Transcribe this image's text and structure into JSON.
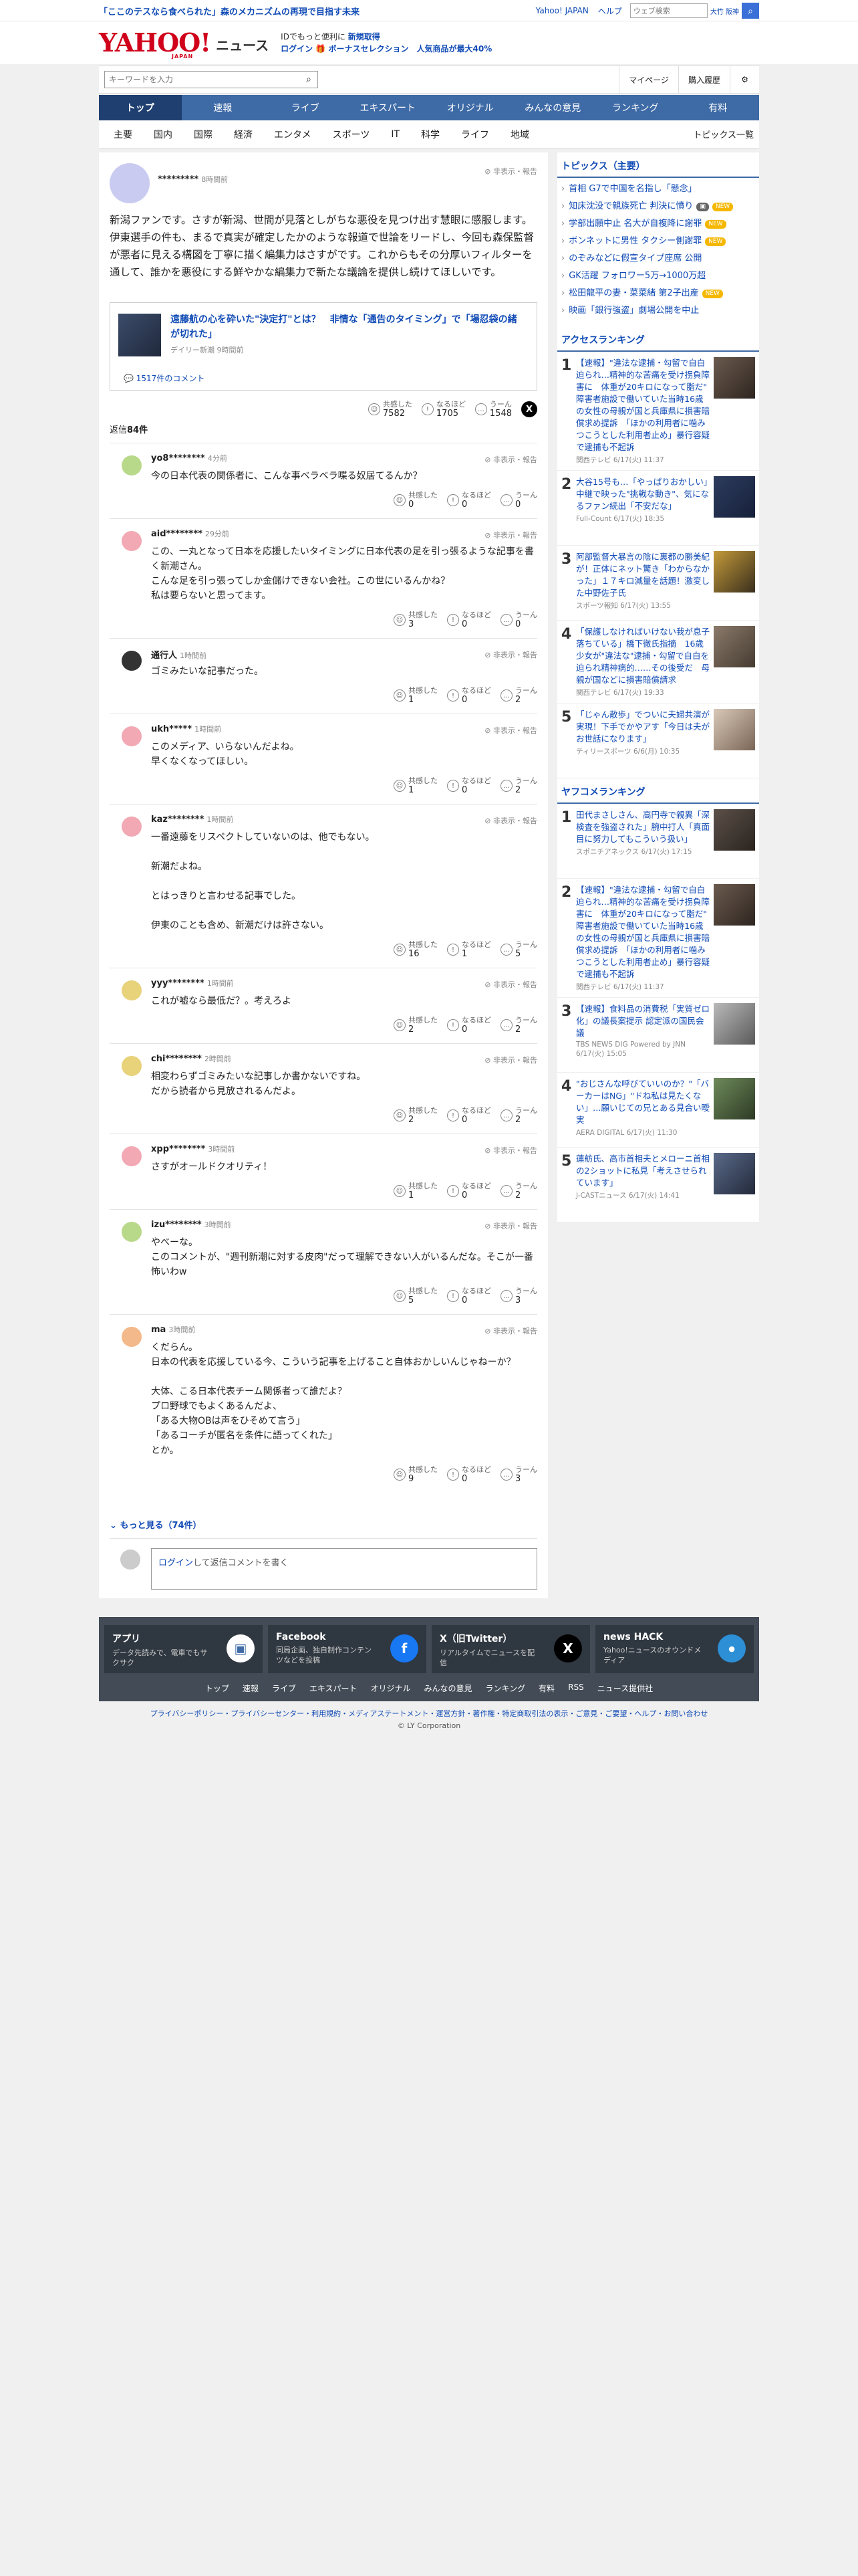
{
  "topbar": {
    "promo": "「ここのテスなら食べられた」森のメカニズムの再現で目指す未来",
    "links": [
      "Yahoo! JAPAN",
      "ヘルプ"
    ],
    "search_placeholder": "ウェブ検索",
    "search_badge": "大竹 阪神"
  },
  "header": {
    "logo": "YAHOO!",
    "logo_sub": "JAPAN",
    "service": "ニュース",
    "msg_line1_prefix": "IDでもっと便利に",
    "msg_line1_link": "新規取得",
    "msg_line2_login": "ログイン",
    "msg_line2_rest": "ボーナスセレクション　人気商品が最大40%"
  },
  "search": {
    "placeholder": "キーワードを入力",
    "links": [
      "マイページ",
      "購入履歴"
    ]
  },
  "nav": {
    "items": [
      "トップ",
      "速報",
      "ライブ",
      "エキスパート",
      "オリジナル",
      "みんなの意見",
      "ランキング",
      "有料"
    ],
    "sub": [
      "主要",
      "国内",
      "国際",
      "経済",
      "エンタメ",
      "スポーツ",
      "IT",
      "科学",
      "ライフ",
      "地域"
    ],
    "topics_all": "トピックス一覧"
  },
  "primary": {
    "user": "*********",
    "time": "8時間前",
    "report": "非表示・報告",
    "body": "新潟ファンです。さすが新潟、世間が見落としがちな悪役を見つけ出す慧眼に感服します。伊東選手の件も、まるで真実が確定したかのような報道で世論をリードし、今回も森保監督が悪者に見える構図を丁寧に描く編集力はさすがです。これからもその分厚いフィルターを通して、誰かを悪役にする鮮やかな編集力で新たな議論を提供し続けてほしいです。",
    "article_title": "遠藤航の心を砕いた\"決定打\"とは？　非情な「通告のタイミング」で「場忍袋の緒が切れた」",
    "article_src": "デイリー新潮 9時間前",
    "article_comments": "1517件のコメント",
    "r1_label": "共感した",
    "r1": "7582",
    "r2_label": "なるほど",
    "r2": "1705",
    "r3_label": "うーん",
    "r3": "1548"
  },
  "reply_count_label": "返信",
  "reply_count": "84件",
  "replies": [
    {
      "user": "yo8********",
      "time": "4分前",
      "text": "今の日本代表の関係者に、こんな事ベラベラ喋る奴居てるんか？",
      "a": "0",
      "b": "0",
      "c": "0",
      "color": "#b9d98a"
    },
    {
      "user": "aid********",
      "time": "29分前",
      "text": "この、一丸となって日本を応援したいタイミングに日本代表の足を引っ張るような記事を書く新潮さん。\nこんな足を引っ張ってしか金儲けできない会社。この世にいるんかね？\n私は要らないと思ってます。",
      "a": "3",
      "b": "0",
      "c": "0",
      "color": "#f2a9b4"
    },
    {
      "user": "通行人",
      "time": "1時間前",
      "text": "ゴミみたいな記事だった。",
      "a": "1",
      "b": "0",
      "c": "2",
      "color": "#333333"
    },
    {
      "user": "ukh*****",
      "time": "1時間前",
      "text": "このメディア、いらないんだよね。\n早くなくなってほしい。",
      "a": "1",
      "b": "0",
      "c": "2",
      "color": "#f2a9b4"
    },
    {
      "user": "kaz********",
      "time": "1時間前",
      "text": "一番遠藤をリスペクトしていないのは、他でもない。\n\n新潮だよね。\n\nとはっきりと言わせる記事でした。\n\n伊東のことも含め、新潮だけは許さない。",
      "a": "16",
      "b": "1",
      "c": "5",
      "color": "#f2a9b4"
    },
    {
      "user": "yyy********",
      "time": "1時間前",
      "text": "これが嘘なら最低だ？。考えろよ",
      "a": "2",
      "b": "0",
      "c": "2",
      "color": "#e8d27a"
    },
    {
      "user": "chi********",
      "time": "2時間前",
      "text": "相変わらずゴミみたいな記事しか書かないですね。\nだから読者から見放されるんだよ。",
      "a": "2",
      "b": "0",
      "c": "2",
      "color": "#e8d27a"
    },
    {
      "user": "xpp********",
      "time": "3時間前",
      "text": "さすがオールドクオリティ！",
      "a": "1",
      "b": "0",
      "c": "2",
      "color": "#f2a9b4"
    },
    {
      "user": "izu********",
      "time": "3時間前",
      "text": "やべーな。\nこのコメントが、\"週刊新潮に対する皮肉\"だって理解できない人がいるんだな。そこが一番怖いわw",
      "a": "5",
      "b": "0",
      "c": "3",
      "color": "#b9d98a"
    },
    {
      "user": "ma",
      "time": "3時間前",
      "text": "くだらん。\n日本の代表を応援している今、こういう記事を上げること自体おかしいんじゃねーか？\n\n大体、こる日本代表チーム関係者って誰だよ？\nプロ野球でもよくあるんだよ、\n「ある大物OBは声をひそめて言う」\n「あるコーチが匿名を条件に語ってくれた」\nとか。",
      "a": "9",
      "b": "0",
      "c": "3",
      "color": "#f4b98a"
    }
  ],
  "reaction_labels": {
    "a": "共感した",
    "b": "なるほど",
    "c": "うーん"
  },
  "more": "もっと見る（74件）",
  "write": {
    "login": "ログイン",
    "rest": "して返信コメントを書く"
  },
  "sidebar": {
    "topics_title": "トピックス（主要）",
    "topics": [
      {
        "t": "首相 G7で中国を名指し「懸念」",
        "tag": ""
      },
      {
        "t": "知床沈没で親族死亡 判決に憤り",
        "tag": "NEW",
        "img": true
      },
      {
        "t": "学部出願中止 名大が自複降に謝罪",
        "tag": "NEW"
      },
      {
        "t": "ボンネットに男性 タクシー側謝罪",
        "tag": "NEW"
      },
      {
        "t": "のぞみなどに假宣タイプ座席 公開",
        "tag": ""
      },
      {
        "t": "GK活躍 フォロワー5万→1000万超",
        "tag": ""
      },
      {
        "t": "松田龍平の妻・菜菜緒 第2子出産",
        "tag": "NEW"
      },
      {
        "t": "映画「銀行強盗」劇場公開を中止",
        "tag": ""
      }
    ],
    "access_title": "アクセスランキング",
    "access": [
      {
        "n": "1",
        "t": "【速報】\"違法な逮捕・勾留で自白迫られ…精神的な苦痛を受け拐負障害に　体重が20キロになって脂だ\"　障害者施設で働いていた当時16歳の女性の母親が国と兵庫県に損害賠償求め提訴　「ほかの利用者に噛みつこうとした利用者止め」暴行容疑で逮捕も不起訴",
        "s": "関西テレビ 6/17(火) 11:37"
      },
      {
        "n": "2",
        "t": "大谷15号も…「やっぱりおかしい」中継で映った\"挑戦な動き\"、気になるファン続出「不安だな」",
        "s": "Full-Count 6/17(火) 18:35"
      },
      {
        "n": "3",
        "t": "阿部監督大暴言の陰に裏都の勝美紀が！正体にネット驚き「わからなかった」１７キロ減量を話題！激変した中野佐子氏",
        "s": "スポーツ報知 6/17(火) 13:55"
      },
      {
        "n": "4",
        "t": "「保護しなければいけない我が息子落ちている」橋下徹氏指摘　16歳少女が\"違法な\"逮捕・勾留で自白を迫られ精神病的……その後受だ　母親が国などに損害賠償請求",
        "s": "関西テレビ 6/17(火) 19:33"
      },
      {
        "n": "5",
        "t": "「じゃん散歩」でついに夫婦共演が実現！下手でかやアす「今日は夫がお世話になります」",
        "s": "ティリースポーツ 6/6(月) 10:35"
      }
    ],
    "comment_title": "ヤフコメランキング",
    "comments": [
      {
        "n": "1",
        "t": "田代まさしさん、高円寺で親異「深検査を強盗された」腕中打人「真面目に努力してもこういう扱い」",
        "s": "スポニチアネックス 6/17(火) 17:15"
      },
      {
        "n": "2",
        "t": "【速報】\"違法な逮捕・勾留で自白迫られ…精神的な苦痛を受け拐負障害に　体重が20キロになって脂だ\"　障害者施設で働いていた当時16歳の女性の母親が国と兵庫県に損害賠償求め提訴　「ほかの利用者に噛みつこうとした利用者止め」暴行容疑で逮捕も不起訴",
        "s": "関西テレビ 6/17(火) 11:37"
      },
      {
        "n": "3",
        "t": "【速報】食料品の消費税「実質ゼロ化」の議長案提示 認定派の国民会議",
        "s": "TBS NEWS DIG Powered by JNN 6/17(火) 15:05"
      },
      {
        "n": "4",
        "t": "\"おじさんな呼びていいのか？\"「バーカーはNG」\"ドね私は見たくない」…願いじての兄とある見合い曖実",
        "s": "AERA DIGITAL 6/17(火) 11:30"
      },
      {
        "n": "5",
        "t": "蓮舫氏、高市首相夫とメローニ首相の2ショットに私見「考えさせられています」",
        "s": "J-CASTニュース 6/17(火) 14:41"
      }
    ]
  },
  "footer": {
    "cards": [
      {
        "t": "アプリ",
        "d": "データ先読みで、電車でもサクサク"
      },
      {
        "t": "Facebook",
        "d": "同局企画、独自制作コンテンツなどを投稿"
      },
      {
        "t": "X（旧Twitter）",
        "d": "リアルタイムでニュースを配信"
      },
      {
        "t": "news HACK",
        "d": "Yahoo!ニュースのオウンドメディア"
      }
    ],
    "links": [
      "トップ",
      "速報",
      "ライブ",
      "エキスパート",
      "オリジナル",
      "みんなの意見",
      "ランキング",
      "有料",
      "RSS",
      "ニュース提供社"
    ],
    "legal": "プライバシーポリシー・プライバシーセンター・利用規約・メディアステートメント・運営方針・著作権・特定商取引法の表示・ご意見・ご要望・ヘルプ・お問い合わせ",
    "copy": "© LY Corporation"
  }
}
